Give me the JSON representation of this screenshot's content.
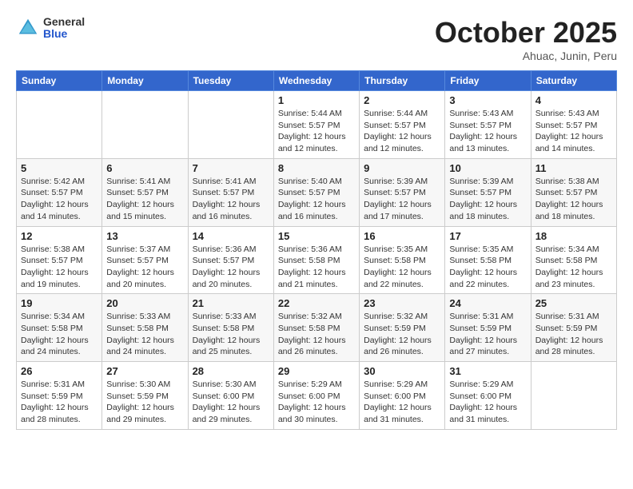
{
  "header": {
    "logo": {
      "general": "General",
      "blue": "Blue"
    },
    "title": "October 2025",
    "location": "Ahuac, Junin, Peru"
  },
  "weekdays": [
    "Sunday",
    "Monday",
    "Tuesday",
    "Wednesday",
    "Thursday",
    "Friday",
    "Saturday"
  ],
  "weeks": [
    [
      {
        "day": "",
        "info": ""
      },
      {
        "day": "",
        "info": ""
      },
      {
        "day": "",
        "info": ""
      },
      {
        "day": "1",
        "info": "Sunrise: 5:44 AM\nSunset: 5:57 PM\nDaylight: 12 hours\nand 12 minutes."
      },
      {
        "day": "2",
        "info": "Sunrise: 5:44 AM\nSunset: 5:57 PM\nDaylight: 12 hours\nand 12 minutes."
      },
      {
        "day": "3",
        "info": "Sunrise: 5:43 AM\nSunset: 5:57 PM\nDaylight: 12 hours\nand 13 minutes."
      },
      {
        "day": "4",
        "info": "Sunrise: 5:43 AM\nSunset: 5:57 PM\nDaylight: 12 hours\nand 14 minutes."
      }
    ],
    [
      {
        "day": "5",
        "info": "Sunrise: 5:42 AM\nSunset: 5:57 PM\nDaylight: 12 hours\nand 14 minutes."
      },
      {
        "day": "6",
        "info": "Sunrise: 5:41 AM\nSunset: 5:57 PM\nDaylight: 12 hours\nand 15 minutes."
      },
      {
        "day": "7",
        "info": "Sunrise: 5:41 AM\nSunset: 5:57 PM\nDaylight: 12 hours\nand 16 minutes."
      },
      {
        "day": "8",
        "info": "Sunrise: 5:40 AM\nSunset: 5:57 PM\nDaylight: 12 hours\nand 16 minutes."
      },
      {
        "day": "9",
        "info": "Sunrise: 5:39 AM\nSunset: 5:57 PM\nDaylight: 12 hours\nand 17 minutes."
      },
      {
        "day": "10",
        "info": "Sunrise: 5:39 AM\nSunset: 5:57 PM\nDaylight: 12 hours\nand 18 minutes."
      },
      {
        "day": "11",
        "info": "Sunrise: 5:38 AM\nSunset: 5:57 PM\nDaylight: 12 hours\nand 18 minutes."
      }
    ],
    [
      {
        "day": "12",
        "info": "Sunrise: 5:38 AM\nSunset: 5:57 PM\nDaylight: 12 hours\nand 19 minutes."
      },
      {
        "day": "13",
        "info": "Sunrise: 5:37 AM\nSunset: 5:57 PM\nDaylight: 12 hours\nand 20 minutes."
      },
      {
        "day": "14",
        "info": "Sunrise: 5:36 AM\nSunset: 5:57 PM\nDaylight: 12 hours\nand 20 minutes."
      },
      {
        "day": "15",
        "info": "Sunrise: 5:36 AM\nSunset: 5:58 PM\nDaylight: 12 hours\nand 21 minutes."
      },
      {
        "day": "16",
        "info": "Sunrise: 5:35 AM\nSunset: 5:58 PM\nDaylight: 12 hours\nand 22 minutes."
      },
      {
        "day": "17",
        "info": "Sunrise: 5:35 AM\nSunset: 5:58 PM\nDaylight: 12 hours\nand 22 minutes."
      },
      {
        "day": "18",
        "info": "Sunrise: 5:34 AM\nSunset: 5:58 PM\nDaylight: 12 hours\nand 23 minutes."
      }
    ],
    [
      {
        "day": "19",
        "info": "Sunrise: 5:34 AM\nSunset: 5:58 PM\nDaylight: 12 hours\nand 24 minutes."
      },
      {
        "day": "20",
        "info": "Sunrise: 5:33 AM\nSunset: 5:58 PM\nDaylight: 12 hours\nand 24 minutes."
      },
      {
        "day": "21",
        "info": "Sunrise: 5:33 AM\nSunset: 5:58 PM\nDaylight: 12 hours\nand 25 minutes."
      },
      {
        "day": "22",
        "info": "Sunrise: 5:32 AM\nSunset: 5:58 PM\nDaylight: 12 hours\nand 26 minutes."
      },
      {
        "day": "23",
        "info": "Sunrise: 5:32 AM\nSunset: 5:59 PM\nDaylight: 12 hours\nand 26 minutes."
      },
      {
        "day": "24",
        "info": "Sunrise: 5:31 AM\nSunset: 5:59 PM\nDaylight: 12 hours\nand 27 minutes."
      },
      {
        "day": "25",
        "info": "Sunrise: 5:31 AM\nSunset: 5:59 PM\nDaylight: 12 hours\nand 28 minutes."
      }
    ],
    [
      {
        "day": "26",
        "info": "Sunrise: 5:31 AM\nSunset: 5:59 PM\nDaylight: 12 hours\nand 28 minutes."
      },
      {
        "day": "27",
        "info": "Sunrise: 5:30 AM\nSunset: 5:59 PM\nDaylight: 12 hours\nand 29 minutes."
      },
      {
        "day": "28",
        "info": "Sunrise: 5:30 AM\nSunset: 6:00 PM\nDaylight: 12 hours\nand 29 minutes."
      },
      {
        "day": "29",
        "info": "Sunrise: 5:29 AM\nSunset: 6:00 PM\nDaylight: 12 hours\nand 30 minutes."
      },
      {
        "day": "30",
        "info": "Sunrise: 5:29 AM\nSunset: 6:00 PM\nDaylight: 12 hours\nand 31 minutes."
      },
      {
        "day": "31",
        "info": "Sunrise: 5:29 AM\nSunset: 6:00 PM\nDaylight: 12 hours\nand 31 minutes."
      },
      {
        "day": "",
        "info": ""
      }
    ]
  ]
}
